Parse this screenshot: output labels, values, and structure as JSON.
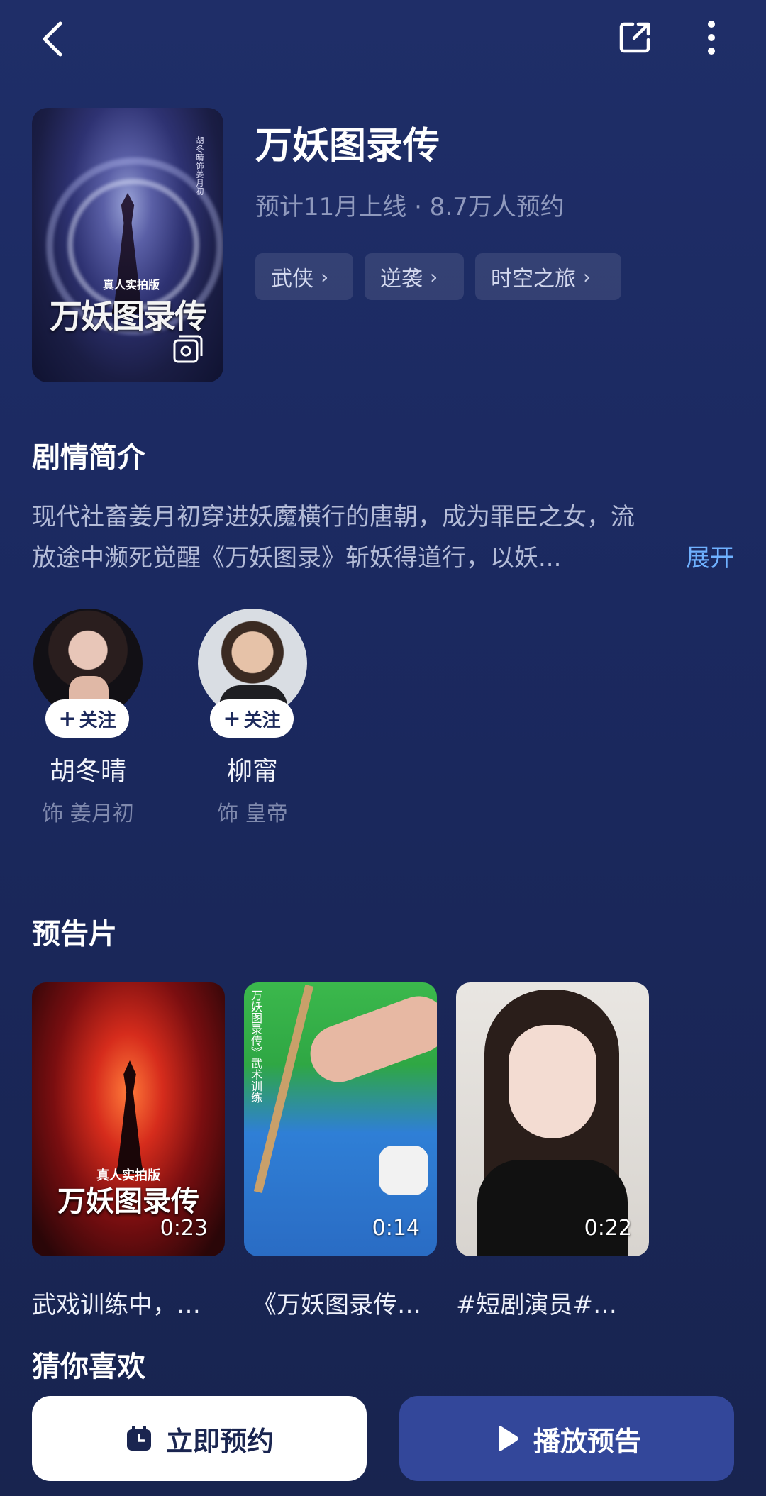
{
  "header": {
    "back_icon": "chevron-left-icon",
    "share_icon": "share-icon",
    "more_icon": "more-vertical-icon"
  },
  "show": {
    "title": "万妖图录传",
    "meta": "预计11月上线 · 8.7万人预约",
    "poster_title_art": "万妖图录传",
    "poster_subtitle_art": "真人实拍版",
    "poster_vertical_text": "胡冬晴饰姜月初",
    "tags": [
      {
        "label": "武侠",
        "chevron": "›"
      },
      {
        "label": "逆袭",
        "chevron": "›"
      },
      {
        "label": "时空之旅",
        "chevron": "›"
      }
    ]
  },
  "synopsis": {
    "heading": "剧情简介",
    "line1": "现代社畜姜月初穿进妖魔横行的唐朝，成为罪臣之女，流",
    "line2": "放途中濒死觉醒《万妖图录》斩妖得道行，以妖...",
    "expand_label": "展开"
  },
  "cast": [
    {
      "name": "胡冬晴",
      "role": "饰 姜月初",
      "follow_label": "关注",
      "follow_icon": "plus-icon"
    },
    {
      "name": "柳甯",
      "role": "饰 皇帝",
      "follow_label": "关注",
      "follow_icon": "plus-icon"
    }
  ],
  "trailers": {
    "heading": "预告片",
    "items": [
      {
        "duration": "0:23",
        "caption": "武戏训练中，…",
        "art_title": "万妖图录传",
        "art_subtitle": "真人实拍版"
      },
      {
        "duration": "0:14",
        "caption": "《万妖图录传…",
        "art_vertical": "万妖图录传》武术训练"
      },
      {
        "duration": "0:22",
        "caption": "#短剧演员#…"
      }
    ]
  },
  "recommend": {
    "heading": "猜你喜欢"
  },
  "actions": {
    "reserve_label": "立即预约",
    "reserve_icon": "calendar-clock-icon",
    "play_label": "播放预告",
    "play_icon": "play-icon"
  },
  "colors": {
    "background": "#1b2960",
    "accent_link": "#6fb1ff",
    "play_button": "#33479a",
    "reserve_button": "#ffffff"
  }
}
